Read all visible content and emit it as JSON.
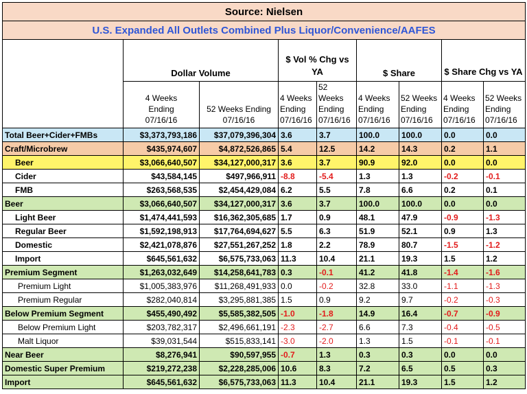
{
  "header": {
    "source": "Source: Nielsen",
    "subtitle": "U.S. Expanded All Outlets Combined Plus Liquor/Convenience/AAFES"
  },
  "groups": {
    "dollar_volume": "Dollar Volume",
    "vol_chg": "$ Vol % Chg vs YA",
    "share": "$ Share",
    "share_chg": "$ Share Chg vs YA"
  },
  "columns": {
    "dv4": "4 Weeks Ending 07/16/16",
    "dv52": "52 Weeks Ending 07/16/16",
    "s4": "4 Weeks Ending 07/16/16",
    "s52": "52 Weeks Ending 07/16/16"
  },
  "colors": {
    "negative": "#e21b1b",
    "header_bg": "#f9d9c6",
    "subtitle": "#2f56d6"
  },
  "rows": [
    {
      "label": "Total Beer+Cider+FMBs",
      "color": "blue",
      "bold": true,
      "indent": 0,
      "dv4": "$3,373,793,186",
      "dv52": "$37,079,396,304",
      "vc4": "3.6",
      "vc52": "3.7",
      "sh4": "100.0",
      "sh52": "100.0",
      "sc4": "0.0",
      "sc52": "0.0"
    },
    {
      "label": "Craft/Microbrew",
      "color": "orange",
      "bold": true,
      "indent": 0,
      "dv4": "$435,974,607",
      "dv52": "$4,872,526,865",
      "vc4": "5.4",
      "vc52": "12.5",
      "sh4": "14.2",
      "sh52": "14.3",
      "sc4": "0.2",
      "sc52": "1.1"
    },
    {
      "label": "Beer",
      "color": "yellow",
      "bold": true,
      "indent": 1,
      "dv4": "$3,066,640,507",
      "dv52": "$34,127,000,317",
      "vc4": "3.6",
      "vc52": "3.7",
      "sh4": "90.9",
      "sh52": "92.0",
      "sc4": "0.0",
      "sc52": "0.0"
    },
    {
      "label": "Cider",
      "color": "white",
      "bold": true,
      "indent": 1,
      "dv4": "$43,584,145",
      "dv52": "$497,966,911",
      "vc4": "-8.8",
      "vc52": "-5.4",
      "sh4": "1.3",
      "sh52": "1.3",
      "sc4": "-0.2",
      "sc52": "-0.1"
    },
    {
      "label": "FMB",
      "color": "white",
      "bold": true,
      "indent": 1,
      "dv4": "$263,568,535",
      "dv52": "$2,454,429,084",
      "vc4": "6.2",
      "vc52": "5.5",
      "sh4": "7.8",
      "sh52": "6.6",
      "sc4": "0.2",
      "sc52": "0.1"
    },
    {
      "label": "Beer",
      "color": "green",
      "bold": true,
      "indent": 0,
      "dv4": "$3,066,640,507",
      "dv52": "$34,127,000,317",
      "vc4": "3.6",
      "vc52": "3.7",
      "sh4": "100.0",
      "sh52": "100.0",
      "sc4": "0.0",
      "sc52": "0.0"
    },
    {
      "label": "Light Beer",
      "color": "white",
      "bold": true,
      "indent": 1,
      "dv4": "$1,474,441,593",
      "dv52": "$16,362,305,685",
      "vc4": "1.7",
      "vc52": "0.9",
      "sh4": "48.1",
      "sh52": "47.9",
      "sc4": "-0.9",
      "sc52": "-1.3"
    },
    {
      "label": "Regular Beer",
      "color": "white",
      "bold": true,
      "indent": 1,
      "dv4": "$1,592,198,913",
      "dv52": "$17,764,694,627",
      "vc4": "5.5",
      "vc52": "6.3",
      "sh4": "51.9",
      "sh52": "52.1",
      "sc4": "0.9",
      "sc52": "1.3"
    },
    {
      "label": "Domestic",
      "color": "white",
      "bold": true,
      "indent": 1,
      "dv4": "$2,421,078,876",
      "dv52": "$27,551,267,252",
      "vc4": "1.8",
      "vc52": "2.2",
      "sh4": "78.9",
      "sh52": "80.7",
      "sc4": "-1.5",
      "sc52": "-1.2"
    },
    {
      "label": "Import",
      "color": "white",
      "bold": true,
      "indent": 1,
      "dv4": "$645,561,632",
      "dv52": "$6,575,733,063",
      "vc4": "11.3",
      "vc52": "10.4",
      "sh4": "21.1",
      "sh52": "19.3",
      "sc4": "1.5",
      "sc52": "1.2"
    },
    {
      "label": "Premium Segment",
      "color": "green",
      "bold": true,
      "indent": 0,
      "dv4": "$1,263,032,649",
      "dv52": "$14,258,641,783",
      "vc4": "0.3",
      "vc52": "-0.1",
      "sh4": "41.2",
      "sh52": "41.8",
      "sc4": "-1.4",
      "sc52": "-1.6"
    },
    {
      "label": "Premium Light",
      "color": "white",
      "bold": false,
      "indent": 2,
      "dv4": "$1,005,383,976",
      "dv52": "$11,268,491,933",
      "vc4": "0.0",
      "vc52": "-0.2",
      "sh4": "32.8",
      "sh52": "33.0",
      "sc4": "-1.1",
      "sc52": "-1.3"
    },
    {
      "label": "Premium Regular",
      "color": "white",
      "bold": false,
      "indent": 2,
      "dv4": "$282,040,814",
      "dv52": "$3,295,881,385",
      "vc4": "1.5",
      "vc52": "0.9",
      "sh4": "9.2",
      "sh52": "9.7",
      "sc4": "-0.2",
      "sc52": "-0.3"
    },
    {
      "label": "Below Premium Segment",
      "color": "green",
      "bold": true,
      "indent": 0,
      "dv4": "$455,490,492",
      "dv52": "$5,585,382,505",
      "vc4": "-1.0",
      "vc52": "-1.8",
      "sh4": "14.9",
      "sh52": "16.4",
      "sc4": "-0.7",
      "sc52": "-0.9"
    },
    {
      "label": "Below Premium Light",
      "color": "white",
      "bold": false,
      "indent": 2,
      "dv4": "$203,782,317",
      "dv52": "$2,496,661,191",
      "vc4": "-2.3",
      "vc52": "-2.7",
      "sh4": "6.6",
      "sh52": "7.3",
      "sc4": "-0.4",
      "sc52": "-0.5"
    },
    {
      "label": "Malt Liquor",
      "color": "white",
      "bold": false,
      "indent": 2,
      "dv4": "$39,031,544",
      "dv52": "$515,833,141",
      "vc4": "-3.0",
      "vc52": "-2.0",
      "sh4": "1.3",
      "sh52": "1.5",
      "sc4": "-0.1",
      "sc52": "-0.1"
    },
    {
      "label": "Near Beer",
      "color": "green",
      "bold": true,
      "indent": 0,
      "dv4": "$8,276,941",
      "dv52": "$90,597,955",
      "vc4": "-0.7",
      "vc52": "1.3",
      "sh4": "0.3",
      "sh52": "0.3",
      "sc4": "0.0",
      "sc52": "0.0"
    },
    {
      "label": "Domestic Super Premium",
      "color": "green",
      "bold": true,
      "indent": 0,
      "dv4": "$219,272,238",
      "dv52": "$2,228,285,006",
      "vc4": "10.6",
      "vc52": "8.3",
      "sh4": "7.2",
      "sh52": "6.5",
      "sc4": "0.5",
      "sc52": "0.3"
    },
    {
      "label": "Import",
      "color": "green",
      "bold": true,
      "indent": 0,
      "dv4": "$645,561,632",
      "dv52": "$6,575,733,063",
      "vc4": "11.3",
      "vc52": "10.4",
      "sh4": "21.1",
      "sh52": "19.3",
      "sc4": "1.5",
      "sc52": "1.2"
    }
  ]
}
